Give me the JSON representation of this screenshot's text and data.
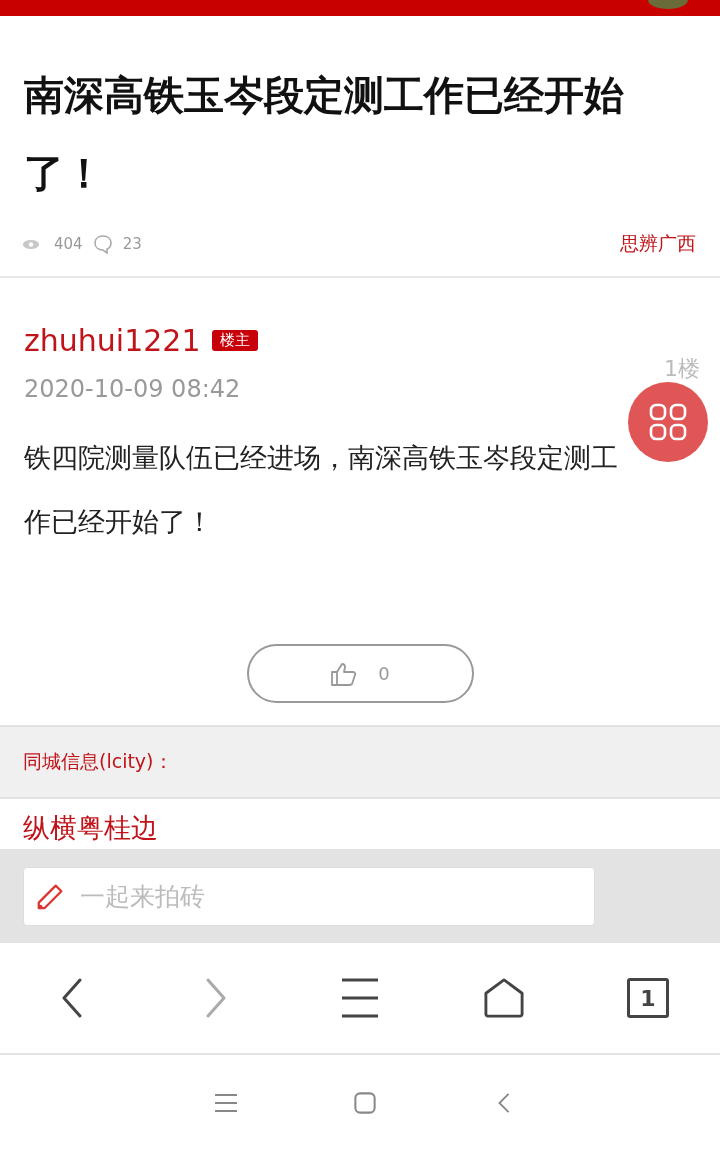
{
  "post_title": "南深高铁玉岑段定测工作已经开始了！",
  "stats": {
    "views": "404",
    "comments": "23",
    "forum": "思辨广西"
  },
  "post": {
    "author": "zhuhui1221",
    "badge": "楼主",
    "time": "2020-10-09 08:42",
    "floor": "1楼",
    "content": "铁四院测量队伍已经进场，南深高铁玉岑段定测工作已经开始了！",
    "likes": "0"
  },
  "city_info": {
    "label": "同城信息(lcity)：",
    "first_item": "纵横粤桂边"
  },
  "comment_bar": {
    "placeholder": "一起来拍砖"
  },
  "browser_toolbar": [
    {
      "kind": "back",
      "disabled": false
    },
    {
      "kind": "forward",
      "disabled": true
    },
    {
      "kind": "menu",
      "disabled": false
    },
    {
      "kind": "home",
      "disabled": false
    },
    {
      "kind": "tabs",
      "disabled": false,
      "count": "1"
    }
  ],
  "system_nav": [
    {
      "kind": "menu"
    },
    {
      "kind": "home"
    },
    {
      "kind": "back"
    }
  ]
}
